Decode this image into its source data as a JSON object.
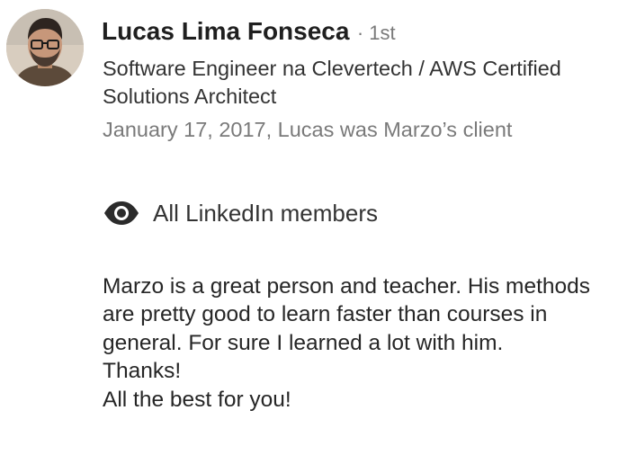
{
  "recommendation": {
    "author": {
      "name": "Lucas Lima Fonseca",
      "degree_separator": "·",
      "degree": "1st",
      "headline": "Software Engineer na Clevertech / AWS Certified Solutions Architect",
      "avatar_icon": "profile-photo"
    },
    "relationship": "January 17, 2017, Lucas was Marzo’s client",
    "visibility": {
      "icon": "eye-icon",
      "label": "All LinkedIn members"
    },
    "paragraphs": [
      "Marzo is a great person and teacher. His methods are pretty good to learn faster than courses in general. For sure I learned a lot with him.",
      "Thanks!",
      "All the best for you!"
    ]
  }
}
